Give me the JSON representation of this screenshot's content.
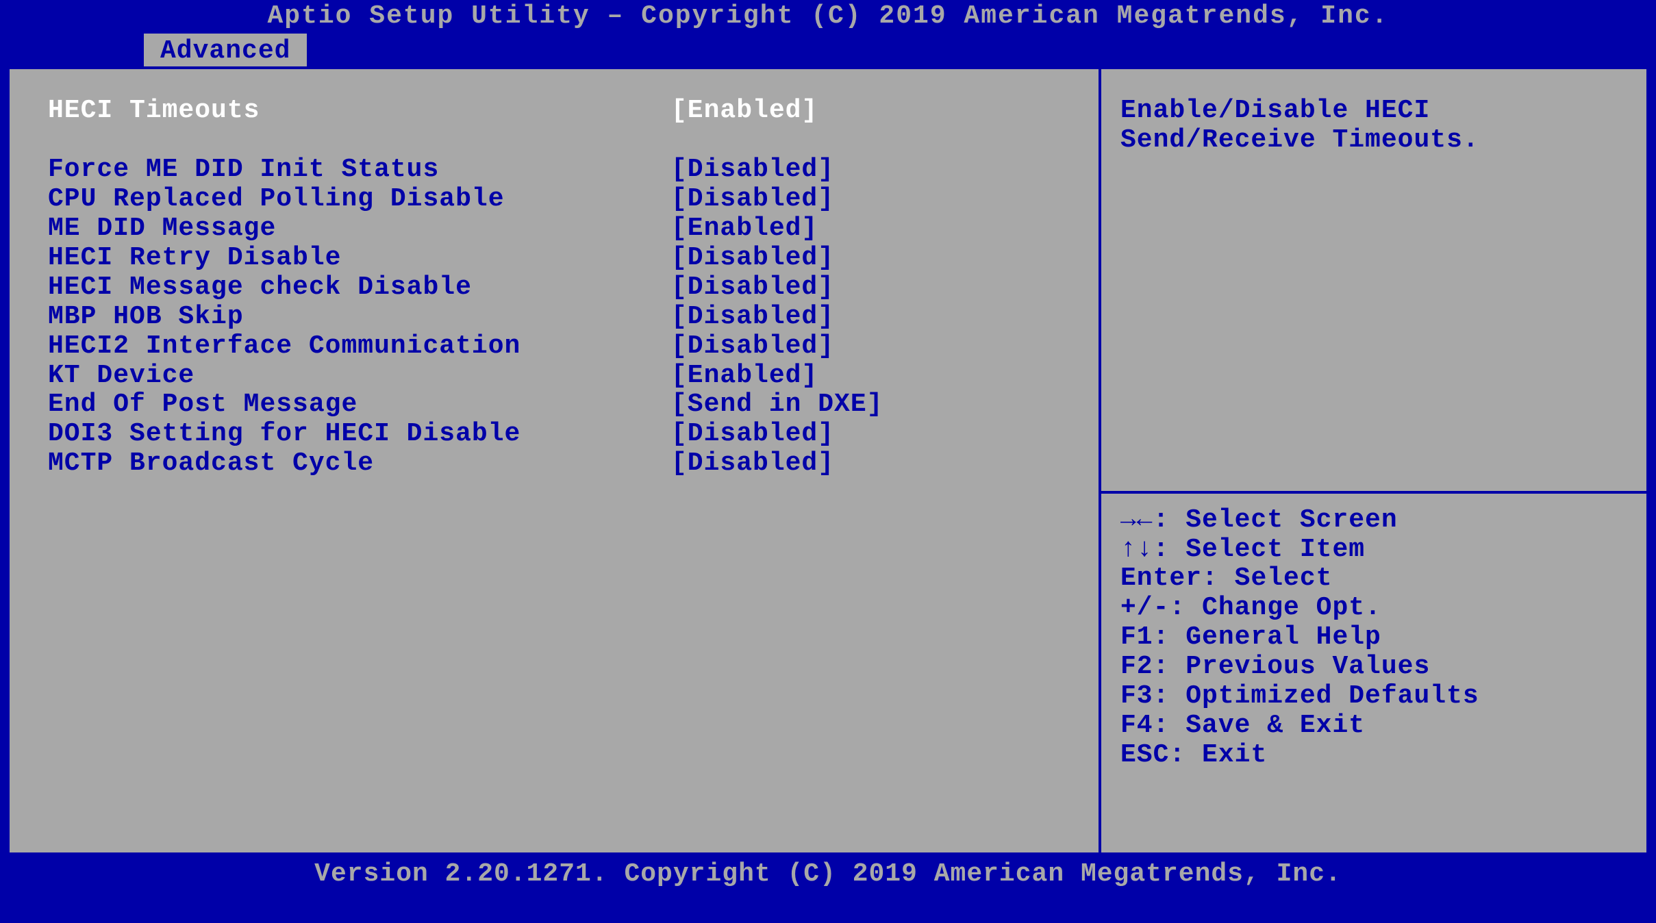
{
  "title": "Aptio Setup Utility – Copyright (C) 2019 American Megatrends, Inc.",
  "tab": "Advanced",
  "help_text": "Enable/Disable HECI Send/Receive Timeouts.",
  "options": [
    {
      "label": "HECI Timeouts",
      "value": "[Enabled]",
      "selected": true
    },
    {
      "label": "",
      "value": "",
      "spacer": true
    },
    {
      "label": "Force ME DID Init Status",
      "value": "[Disabled]"
    },
    {
      "label": "CPU Replaced Polling Disable",
      "value": "[Disabled]"
    },
    {
      "label": "ME DID Message",
      "value": "[Enabled]"
    },
    {
      "label": "HECI Retry Disable",
      "value": "[Disabled]"
    },
    {
      "label": "HECI Message check Disable",
      "value": "[Disabled]"
    },
    {
      "label": "MBP HOB Skip",
      "value": "[Disabled]"
    },
    {
      "label": "HECI2 Interface Communication",
      "value": "[Disabled]"
    },
    {
      "label": "KT Device",
      "value": "[Enabled]"
    },
    {
      "label": "End Of Post Message",
      "value": "[Send in DXE]"
    },
    {
      "label": "DOI3 Setting for HECI Disable",
      "value": "[Disabled]"
    },
    {
      "label": "MCTP Broadcast Cycle",
      "value": "[Disabled]"
    }
  ],
  "hotkeys": [
    {
      "keys": "→←",
      "desc": ": Select Screen"
    },
    {
      "keys": "↑↓",
      "desc": ": Select Item"
    },
    {
      "keys": "Enter",
      "desc": ": Select"
    },
    {
      "keys": "+/-",
      "desc": ": Change Opt."
    },
    {
      "keys": "F1",
      "desc": ": General Help"
    },
    {
      "keys": "F2",
      "desc": ": Previous Values"
    },
    {
      "keys": "F3",
      "desc": ": Optimized Defaults"
    },
    {
      "keys": "F4",
      "desc": ": Save & Exit"
    },
    {
      "keys": "ESC",
      "desc": ": Exit"
    }
  ],
  "footer": "Version 2.20.1271. Copyright (C) 2019 American Megatrends, Inc."
}
